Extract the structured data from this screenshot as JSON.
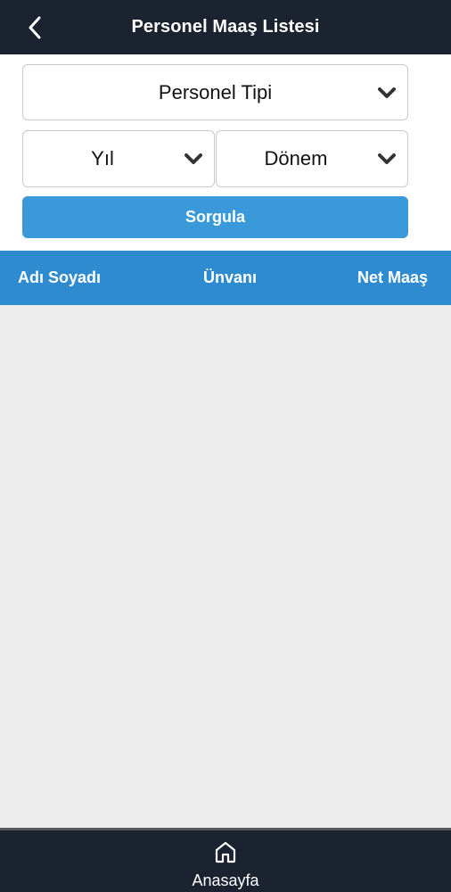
{
  "header": {
    "title": "Personel Maaş Listesi",
    "back_icon": "chevron-left-icon"
  },
  "filters": {
    "personnel_type": {
      "value": "Personel Tipi",
      "icon": "chevron-down-icon"
    },
    "year": {
      "value": "Yıl",
      "icon": "chevron-down-icon"
    },
    "period": {
      "value": "Dönem",
      "icon": "chevron-down-icon"
    },
    "query_button": "Sorgula"
  },
  "table": {
    "columns": [
      "Adı Soyadı",
      "Ünvanı",
      "Net Maaş"
    ],
    "rows": []
  },
  "bottom_nav": {
    "home_label": "Anasayfa",
    "home_icon": "home-icon"
  },
  "colors": {
    "header_bg": "#1b2230",
    "button_bg": "#3a9ad9",
    "table_header_bg": "#2f8bcf",
    "list_bg": "#ececed"
  }
}
